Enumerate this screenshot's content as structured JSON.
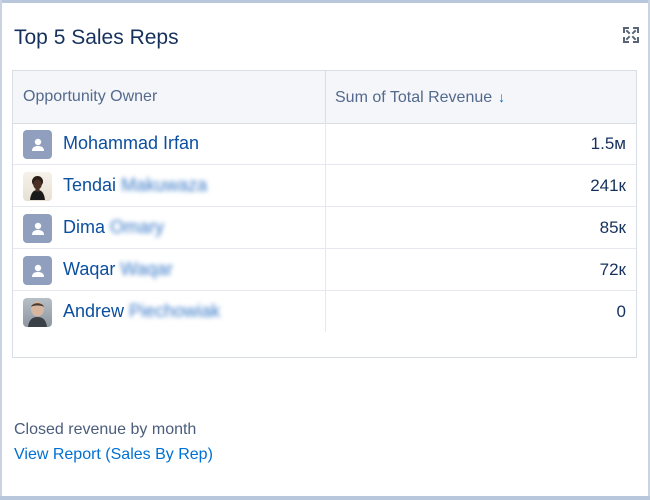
{
  "widget": {
    "title": "Top 5 Sales Reps",
    "expand_icon": "expand-icon",
    "table": {
      "headers": {
        "owner": "Opportunity Owner",
        "revenue": "Sum of Total Revenue"
      },
      "sort": {
        "column": "Sum of Total Revenue",
        "direction": "descending"
      },
      "rows": [
        {
          "first": "Mohammad Irfan",
          "last": "",
          "value": "1.5м",
          "avatar": "user-icon"
        },
        {
          "first": "Tendai",
          "last": "Makuwaza",
          "value": "241к",
          "avatar": "photo"
        },
        {
          "first": "Dima",
          "last": "Omary",
          "value": "85к",
          "avatar": "user-icon"
        },
        {
          "first": "Waqar",
          "last": "Waqar",
          "value": "72к",
          "avatar": "user-icon"
        },
        {
          "first": "Andrew",
          "last": "Piechowiak",
          "value": "0",
          "avatar": "photo"
        }
      ]
    },
    "footer": {
      "subtitle": "Closed revenue by month",
      "link": "View Report (Sales By Rep)"
    }
  }
}
